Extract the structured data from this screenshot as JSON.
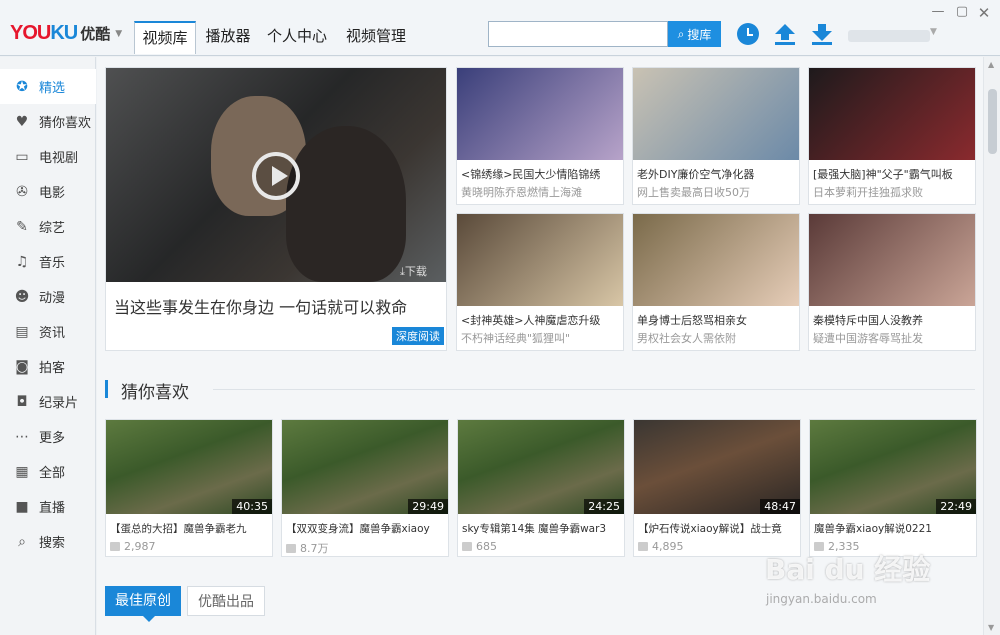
{
  "app": {
    "logo_text_a": "YOU",
    "logo_text_b": "KU",
    "logo_cn": "优酷"
  },
  "nav": {
    "tabs": [
      {
        "label": "视频库"
      },
      {
        "label": "播放器"
      },
      {
        "label": "个人中心"
      },
      {
        "label": "视频管理"
      }
    ]
  },
  "search": {
    "placeholder": "",
    "value": "",
    "button_label": "搜库"
  },
  "sidebar": {
    "items": [
      {
        "label": "精选",
        "icon": "badge-icon"
      },
      {
        "label": "猜你喜欢",
        "icon": "heart-icon"
      },
      {
        "label": "电视剧",
        "icon": "tv-icon"
      },
      {
        "label": "电影",
        "icon": "film-reel-icon"
      },
      {
        "label": "综艺",
        "icon": "microphone-icon"
      },
      {
        "label": "音乐",
        "icon": "music-note-icon"
      },
      {
        "label": "动漫",
        "icon": "bear-icon"
      },
      {
        "label": "资讯",
        "icon": "news-icon"
      },
      {
        "label": "拍客",
        "icon": "camcorder-icon"
      },
      {
        "label": "纪录片",
        "icon": "camera-icon"
      },
      {
        "label": "更多",
        "icon": "more-icon"
      },
      {
        "label": "全部",
        "icon": "grid-icon"
      },
      {
        "label": "直播",
        "icon": "live-icon"
      },
      {
        "label": "搜索",
        "icon": "search-icon"
      }
    ]
  },
  "hero": {
    "title": "当这些事发生在你身边 一句话就可以救命",
    "tag": "深度阅读",
    "download_label": "下载"
  },
  "featured": [
    {
      "title": "<锦绣缘>民国大少情陷锦绣",
      "sub": "黄晓明陈乔恩燃情上海滩",
      "colors": [
        "#3a3f7a",
        "#b7a3c9"
      ]
    },
    {
      "title": "老外DIY廉价空气净化器",
      "sub": "网上售卖最高日收50万",
      "colors": [
        "#c9c2b3",
        "#6c8aa8"
      ]
    },
    {
      "title": "[最强大脑]神\"父子\"霸气叫板",
      "sub": "日本萝莉开挂独孤求败",
      "colors": [
        "#1e1a1c",
        "#8a2a2e"
      ]
    },
    {
      "title": "<封神英雄>人神魔虐恋升级",
      "sub": "不朽神话经典\"狐狸叫\"",
      "colors": [
        "#5a4a3a",
        "#d8c6a6"
      ]
    },
    {
      "title": "单身博士后怒骂相亲女",
      "sub": "男权社会女人需依附",
      "colors": [
        "#7a6a4a",
        "#e6cdb8"
      ]
    },
    {
      "title": "秦模特斥中国人没教养",
      "sub": "疑遭中国游客辱骂扯发",
      "colors": [
        "#5a3a38",
        "#caa597"
      ]
    }
  ],
  "section": {
    "title": "猜你喜欢"
  },
  "videos": [
    {
      "title": "【蛋总的大招】魔兽争霸老九",
      "duration": "40:35",
      "views": "2,987"
    },
    {
      "title": "【双双变身流】魔兽争霸xiaoy",
      "duration": "29:49",
      "views": "8.7万"
    },
    {
      "title": "sky专辑第14集 魔兽争霸war3",
      "duration": "24:25",
      "views": "685"
    },
    {
      "title": "【炉石传说xiaoy解说】战士竟",
      "duration": "48:47",
      "views": "4,895"
    },
    {
      "title": "魔兽争霸xiaoy解说0221",
      "duration": "22:49",
      "views": "2,335"
    }
  ],
  "bottom_tabs": [
    {
      "label": "最佳原创"
    },
    {
      "label": "优酷出品"
    }
  ],
  "watermark": {
    "brand": "Bai du 经验",
    "url": "jingyan.baidu.com"
  },
  "colors": {
    "accent": "#1a87d8",
    "logo_red": "#e6162d"
  }
}
